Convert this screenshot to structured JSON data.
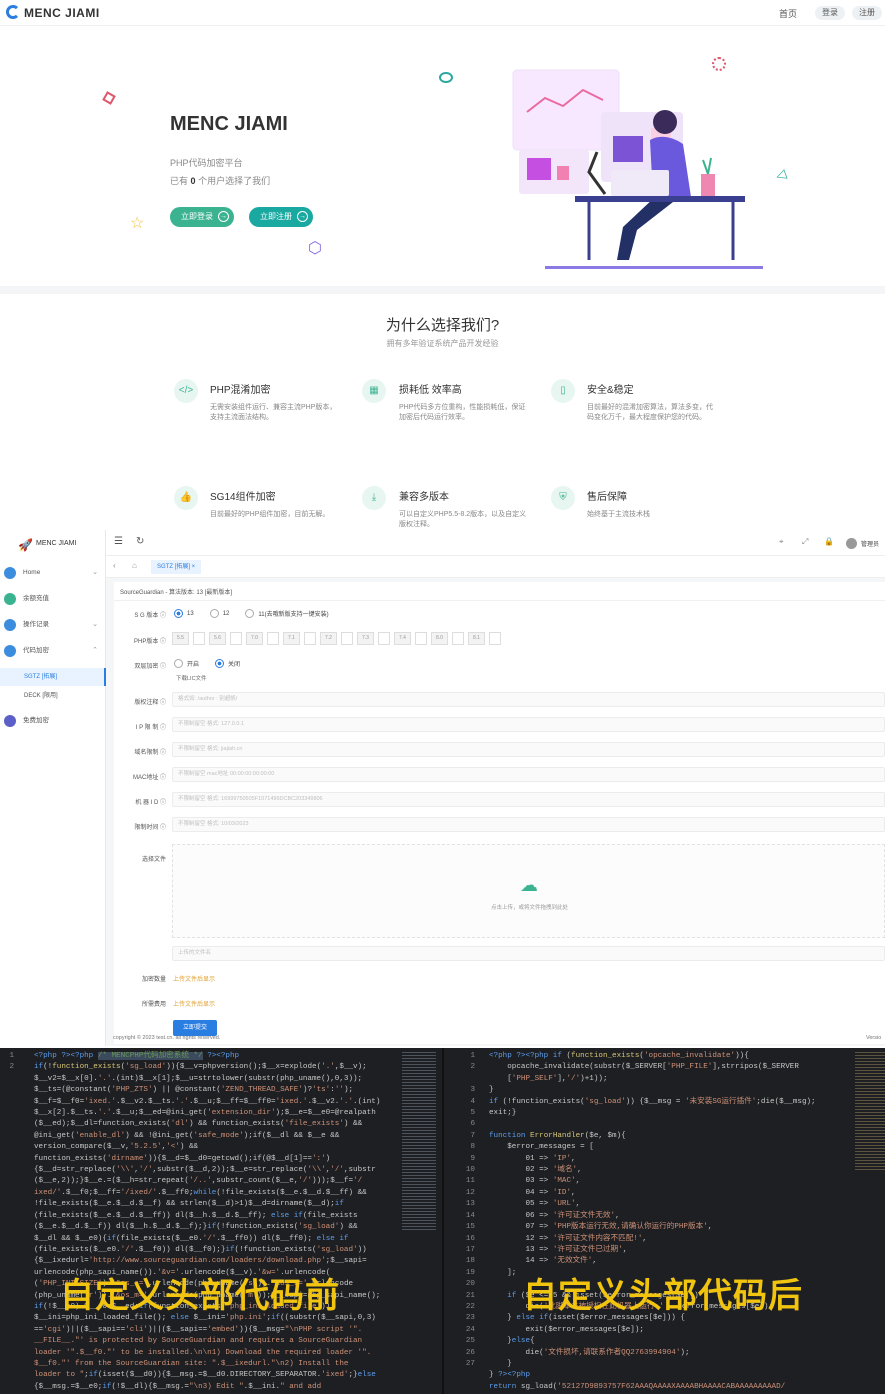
{
  "header": {
    "brand": "MENC JIAMI",
    "nav_home": "首页",
    "login": "登录",
    "register": "注册"
  },
  "hero": {
    "title": "MENC JIAMI",
    "subtitle": "PHP代码加密平台",
    "count_prefix": "已有",
    "count": "0",
    "count_suffix": "个用户选择了我们",
    "btn_login": "立即登录",
    "btn_register": "立即注册"
  },
  "why": {
    "title": "为什么选择我们?",
    "subtitle": "拥有多年验证系统产品开发经验",
    "features": [
      {
        "title": "PHP混淆加密",
        "desc": "无需安装组件运行、兼容主流PHP版本，支持主流面法结构。"
      },
      {
        "title": "损耗低 效率高",
        "desc": "PHP代码多方位重构，性能损耗低，保证加密后代码运行效率。"
      },
      {
        "title": "安全&稳定",
        "desc": "目前最好的混淆加密算法，算法多变，代码变化万千，最大程度保护您的代码。"
      },
      {
        "title": "SG14组件加密",
        "desc": "目前最好的PHP组件加密，目前无解。"
      },
      {
        "title": "兼容多版本",
        "desc": "可以自定义PHP5.5-8.2版本，以及自定义版权注释。"
      },
      {
        "title": "售后保障",
        "desc": "始终基于主流技术栈"
      }
    ]
  },
  "admin": {
    "brand": "MENC JIAMI",
    "header_user": "管理员",
    "menu": [
      {
        "label": "Home"
      },
      {
        "label": "余额充值"
      },
      {
        "label": "操作记录"
      },
      {
        "label": "代码加密"
      }
    ],
    "submenu": [
      {
        "label": "SGTZ [拓展]"
      },
      {
        "label": "DECK [限用]"
      }
    ],
    "menu_free": "免费加密",
    "tab": "SGTZ [拓展]",
    "panel_title": "SourceGuardian - 算法版本: 13 [最新版本]",
    "sg_label": "S G 版本",
    "sg_opts": [
      "13",
      "12",
      "11(去哦新版支持一键安装)"
    ],
    "php_label": "PHP版本",
    "php_versions": [
      "5.5",
      "5.6",
      "7.0",
      "7.1",
      "7.2",
      "7.3",
      "7.4",
      "8.0",
      "8.1"
    ],
    "dual_label": "双层加密",
    "dual_on": "开启",
    "dual_off": "关闭",
    "dual_note": "下载LIC文件",
    "copyright_label": "版权注释",
    "copyright_ph": "格式如: /author : 别超帆/",
    "ip_label": "I P 限 制",
    "ip_ph": "不限制留空 格式: 127.0.0.1",
    "domain_label": "域名限制",
    "domain_ph": "不限制留空 格式: jiajiah.cn",
    "mac_label": "MAC地址",
    "mac_ph": "不限制留空 mac地址 00:00:00:00:00:00",
    "machine_label": "机 器 I D",
    "machine_ph": "不限制留空 格式: 16999750505F1071496DCBC203349806",
    "time_label": "限制时间",
    "time_ph": "不限制留空 格式: 10/03/2023",
    "file_label": "选择文件",
    "upload_text": "点击上传，或将文件拖拽到此处",
    "upload_ph": "上传的文件名",
    "fee_label": "加密数量",
    "fee_value": "上传文件后显示",
    "cost_label": "所需费用",
    "cost_value": "上传文件后显示",
    "submit": "立即提交",
    "footer": "copyright © 2023 test.cn. all rights reserved.",
    "footer_right": "Versio"
  },
  "code": {
    "left_caption": "自定义头部代码前",
    "right_caption": "自定义头部代码后"
  },
  "colors": {
    "accent": "#2a7de1",
    "green": "#3bb391",
    "teal": "#1aa9a0",
    "caption": "#f1c40f"
  }
}
